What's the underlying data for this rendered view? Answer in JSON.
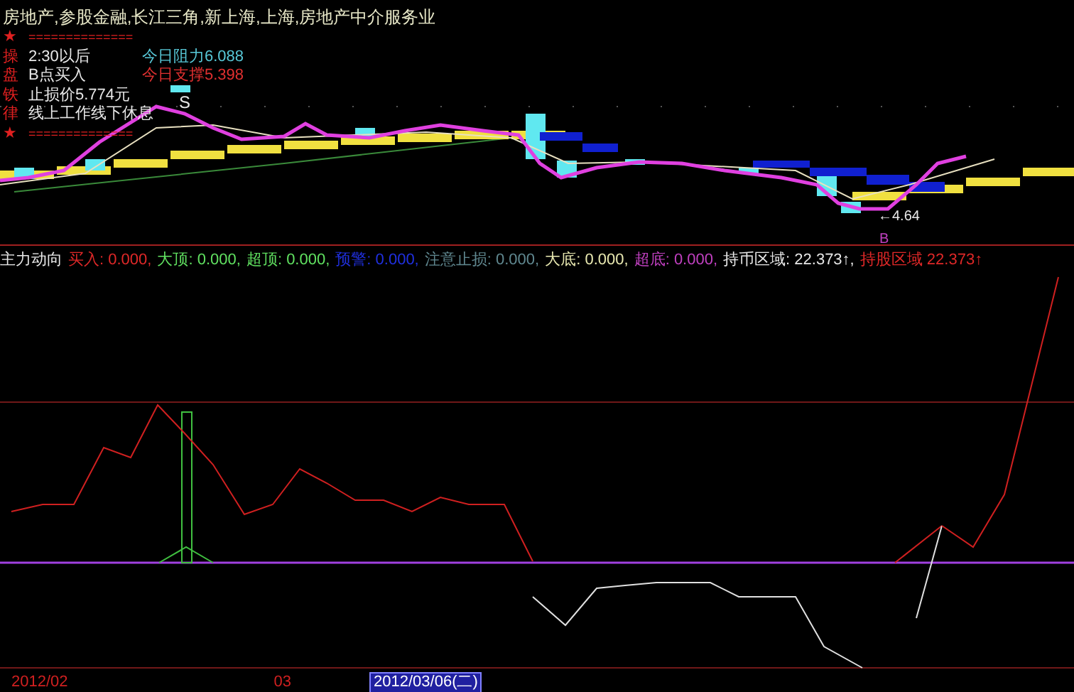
{
  "title": "房地产,参股金融,长江三角,新上海,上海,房地产中介服务业",
  "notes": [
    {
      "mark": "★",
      "kind": "separator",
      "text": "=============="
    },
    {
      "mark": "操",
      "kind": "text",
      "text": "2:30以后",
      "extra": {
        "text": "今日阻力6.088",
        "color": "#58c8d8"
      }
    },
    {
      "mark": "盘",
      "kind": "text",
      "text": "B点买入",
      "extra": {
        "text": "今日支撑5.398",
        "color": "#e03030"
      }
    },
    {
      "mark": "铁",
      "kind": "text",
      "text": "止损价5.774元"
    },
    {
      "mark": "律",
      "kind": "text",
      "text": "线上工作线下休息"
    },
    {
      "mark": "★",
      "kind": "separator",
      "text": "=============="
    }
  ],
  "price_chart": {
    "sell_mark": "S",
    "low_label": "←4.64",
    "buy_mark": "B"
  },
  "indicator": {
    "name": "主力动向",
    "legend": [
      {
        "label": "买入:",
        "value": "0.000,",
        "color": "#e02828"
      },
      {
        "label": "大顶:",
        "value": "0.000,",
        "color": "#60e060"
      },
      {
        "label": "超顶:",
        "value": "0.000,",
        "color": "#60e060"
      },
      {
        "label": "预警:",
        "value": "0.000,",
        "color": "#2030e0"
      },
      {
        "label": "注意止损:",
        "value": "0.000,",
        "color": "#608890"
      },
      {
        "label": "大底:",
        "value": "0.000,",
        "color": "#e8e8b0"
      },
      {
        "label": "超底:",
        "value": "0.000,",
        "color": "#c040c0"
      },
      {
        "label": "持币区域:",
        "value": "22.373↑,",
        "color": "#e8e8e8"
      },
      {
        "label": "持股区域",
        "value": "22.373↑",
        "color": "#e02828"
      }
    ]
  },
  "axis": [
    {
      "text": "2012/02",
      "selected": false
    },
    {
      "text": "03",
      "selected": false
    },
    {
      "text": "2012/03/06(二)",
      "selected": true
    }
  ]
}
